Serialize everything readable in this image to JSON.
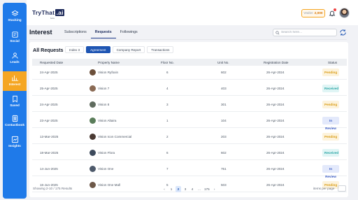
{
  "sidebar": {
    "items": [
      {
        "label": "Stacking",
        "icon": "layers-icon",
        "active": false
      },
      {
        "label": "Social",
        "icon": "social-feed-icon",
        "active": false
      },
      {
        "label": "Leads",
        "icon": "leads-icon",
        "active": false
      },
      {
        "label": "Interest",
        "icon": "interest-icon",
        "active": true
      },
      {
        "label": "Saved",
        "icon": "bookmark-icon",
        "active": false
      },
      {
        "label": "Contactbook",
        "icon": "contactbook-icon",
        "active": false
      },
      {
        "label": "Insights",
        "icon": "insights-icon",
        "active": false
      }
    ]
  },
  "header": {
    "logo": {
      "text": "TryThat",
      "ai": ".ai",
      "sub": "beta"
    },
    "wallet": {
      "label": "Wallet",
      "value": "2,000"
    },
    "icons": {
      "bell": "bell-icon",
      "avatar": "user-avatar"
    }
  },
  "page": {
    "title": "Interest",
    "tabs": [
      {
        "label": "Subscriptions",
        "active": false
      },
      {
        "label": "Requests",
        "active": true
      },
      {
        "label": "Followings",
        "active": false
      }
    ],
    "search": {
      "placeholder": "Search here..."
    }
  },
  "card": {
    "title": "All Requests",
    "subtabs": [
      {
        "label": "Index 3",
        "active": false
      },
      {
        "label": "Agreement",
        "active": true
      },
      {
        "label": "Company Report",
        "active": false
      },
      {
        "label": "Transactions",
        "active": false
      }
    ],
    "columns": [
      "Requested Date",
      "Property Name",
      "Floor No.",
      "Unit No.",
      "Registration Date",
      "Status"
    ],
    "rows": [
      {
        "requested": "24-Apr-2025",
        "property": "Vision Ryfoxin",
        "floor": "6",
        "unit": "602",
        "registration": "26-Apr-2024",
        "status": "Pending",
        "status_type": "pending",
        "avatar_color": "#6b4f3a"
      },
      {
        "requested": "25-Apr-2025",
        "property": "Vision 7",
        "floor": "4",
        "unit": "403",
        "registration": "26-Apr-2024",
        "status": "Received",
        "status_type": "received",
        "avatar_color": "#8a6a54"
      },
      {
        "requested": "24-Apr-2025",
        "property": "Vision 8",
        "floor": "3",
        "unit": "301",
        "registration": "26-Apr-2024",
        "status": "Pending",
        "status_type": "pending",
        "avatar_color": "#5f6b5e"
      },
      {
        "requested": "23-Apr-2025",
        "property": "Vision Altaira",
        "floor": "1",
        "unit": "104",
        "registration": "26-Apr-2024",
        "status": "In Review",
        "status_type": "review",
        "avatar_color": "#5a7d5a"
      },
      {
        "requested": "13-Mar-2025",
        "property": "Vision Icon Commercial",
        "floor": "2",
        "unit": "203",
        "registration": "26-Apr-2024",
        "status": "Pending",
        "status_type": "pending",
        "avatar_color": "#4a3a33"
      },
      {
        "requested": "18-Mar-2025",
        "property": "Vision Flora",
        "floor": "6",
        "unit": "602",
        "registration": "26-Apr-2024",
        "status": "Received",
        "status_type": "received",
        "avatar_color": "#3d4a5c"
      },
      {
        "requested": "14-Jun-2025",
        "property": "Vision One",
        "floor": "7",
        "unit": "751",
        "registration": "26-Apr-2024",
        "status": "In Review",
        "status_type": "review",
        "avatar_color": "#4e5a6b"
      },
      {
        "requested": "16-Jun-2025",
        "property": "Vision One Mall",
        "floor": "5",
        "unit": "503",
        "registration": "26-Apr-2024",
        "status": "Pending",
        "status_type": "pending",
        "avatar_color": "#6d5848"
      }
    ],
    "footer": {
      "showing": "Showing 2-10 / 175 Results",
      "pages": [
        "‹",
        "1",
        "2",
        "3",
        "4",
        "...",
        "175",
        "›"
      ],
      "active_page": "2",
      "per_page_label": "items per page"
    }
  },
  "colors": {
    "sidebar": "#1f7ae9",
    "sidebar_active": "#f5a623",
    "accent": "#1e55b3",
    "pending": "#d89b14",
    "received": "#2ba5a5",
    "review": "#3b5cc4"
  }
}
